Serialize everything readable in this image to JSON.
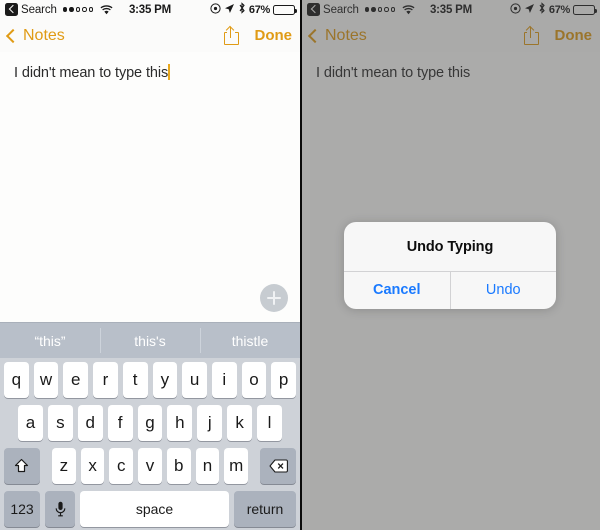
{
  "statusbar": {
    "back_label": "Search",
    "signal_dots_filled": 2,
    "signal_dots_total": 5,
    "wifi_icon": "wifi-icon",
    "time": "3:35 PM",
    "location_icon": "location-arrow-icon",
    "alarm_icon": "alarm-icon",
    "bluetooth_icon": "bluetooth-icon",
    "battery_percent": "67%",
    "battery_level": 67
  },
  "navbar": {
    "back_label": "Notes",
    "share_icon": "share-icon",
    "done_label": "Done"
  },
  "note": {
    "text": "I didn't mean to type this",
    "add_button_icon": "plus-icon"
  },
  "suggestions": [
    {
      "label": "“this”"
    },
    {
      "label": "this's"
    },
    {
      "label": "thistle"
    }
  ],
  "keyboard": {
    "row1": [
      "q",
      "w",
      "e",
      "r",
      "t",
      "y",
      "u",
      "i",
      "o",
      "p"
    ],
    "row2": [
      "a",
      "s",
      "d",
      "f",
      "g",
      "h",
      "j",
      "k",
      "l"
    ],
    "row3": [
      "z",
      "x",
      "c",
      "v",
      "b",
      "n",
      "m"
    ],
    "shift_icon": "shift-arrow-icon",
    "delete_icon": "backspace-icon",
    "numbers_label": "123",
    "mic_icon": "microphone-icon",
    "space_label": "space",
    "return_label": "return"
  },
  "alert": {
    "title": "Undo Typing",
    "cancel_label": "Cancel",
    "undo_label": "Undo"
  },
  "colors": {
    "accent_gold": "#e09b15",
    "alert_blue": "#1a7aff",
    "keyboard_bg": "#ced2d8",
    "suggestion_bg": "#b8bfc9"
  }
}
